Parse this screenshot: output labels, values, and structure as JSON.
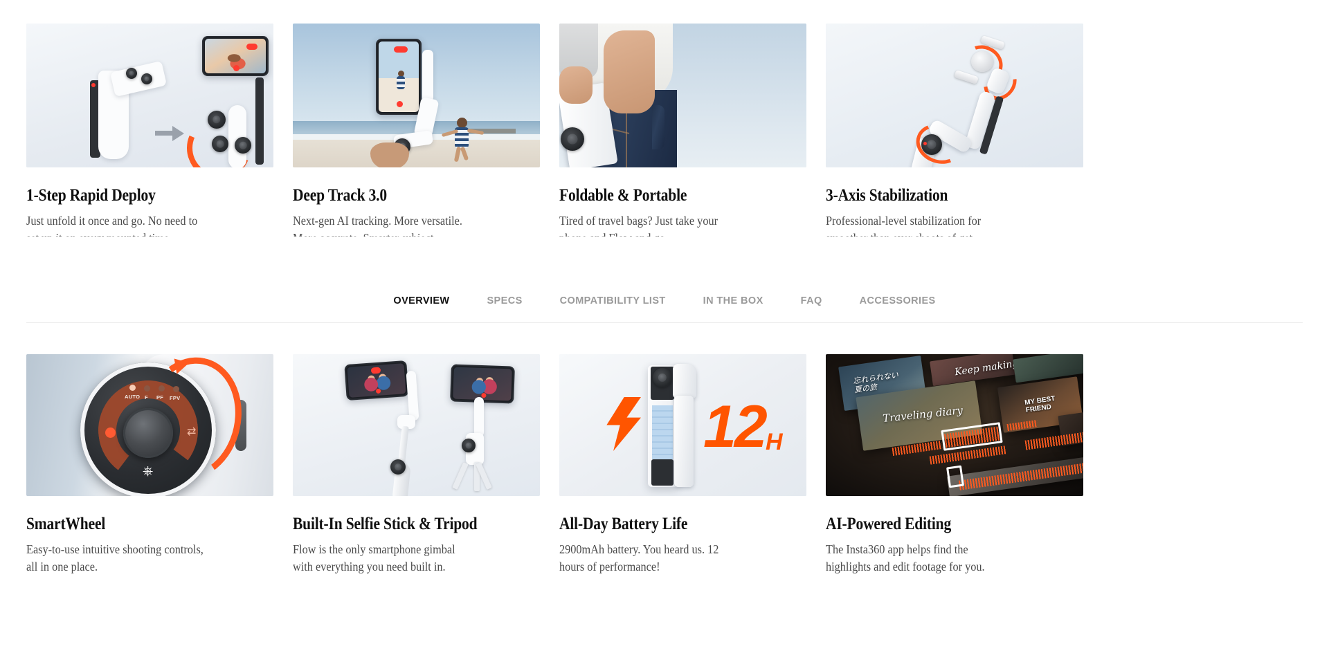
{
  "accent_color": "#FF5500",
  "nav": {
    "tabs": [
      {
        "label": "OVERVIEW",
        "active": true
      },
      {
        "label": "SPECS",
        "active": false
      },
      {
        "label": "COMPATIBILITY LIST",
        "active": false
      },
      {
        "label": "IN THE BOX",
        "active": false
      },
      {
        "label": "FAQ",
        "active": false
      },
      {
        "label": "ACCESSORIES",
        "active": false
      }
    ]
  },
  "features_top": [
    {
      "title": "1-Step Rapid Deploy",
      "desc": "Just unfold it once and go. No need to",
      "desc_clipped": "set up it on every mounted time.",
      "image": "gimbal-unfold-diagram"
    },
    {
      "title": "Deep Track 3.0",
      "desc": "Next-gen AI tracking. More versatile.",
      "desc_clipped": "More accurate. Smarter subject.",
      "image": "beach-tracking-photo"
    },
    {
      "title": "Foldable & Portable",
      "desc": "Tired of travel bags? Just take your",
      "desc_clipped": "phone and Flow and go.",
      "image": "pocket-carry-photo"
    },
    {
      "title": "3-Axis Stabilization",
      "desc": "Professional-level stabilization for",
      "desc_clipped": "smoother than ever shoots of get.",
      "image": "three-axis-rotation-diagram"
    }
  ],
  "features_bottom": [
    {
      "title": "SmartWheel",
      "desc_line1": "Easy-to-use intuitive shooting controls,",
      "desc_line2": "all in one place.",
      "image": "smartwheel-dial-closeup",
      "dial_modes": [
        "AUTO",
        "F",
        "PF",
        "FPV"
      ]
    },
    {
      "title": "Built-In Selfie Stick & Tripod",
      "desc_line1": "Flow is the only smartphone gimbal",
      "desc_line2": "with everything you need built in.",
      "image": "selfie-stick-and-tripod-photo"
    },
    {
      "title": "All-Day Battery Life",
      "desc_line1": "2900mAh battery. You heard us. 12",
      "desc_line2": "hours of performance!",
      "image": "battery-cutaway-graphic",
      "badge_number": "12",
      "badge_unit": "H"
    },
    {
      "title": "AI-Powered Editing",
      "desc_line1": "The Insta360 app helps find the",
      "desc_line2": "highlights and edit footage for you.",
      "image": "ai-editing-timeline-photo",
      "overlay_texts": [
        "Keep making",
        "Traveling diary",
        "MY BEST FRIEND"
      ]
    }
  ]
}
